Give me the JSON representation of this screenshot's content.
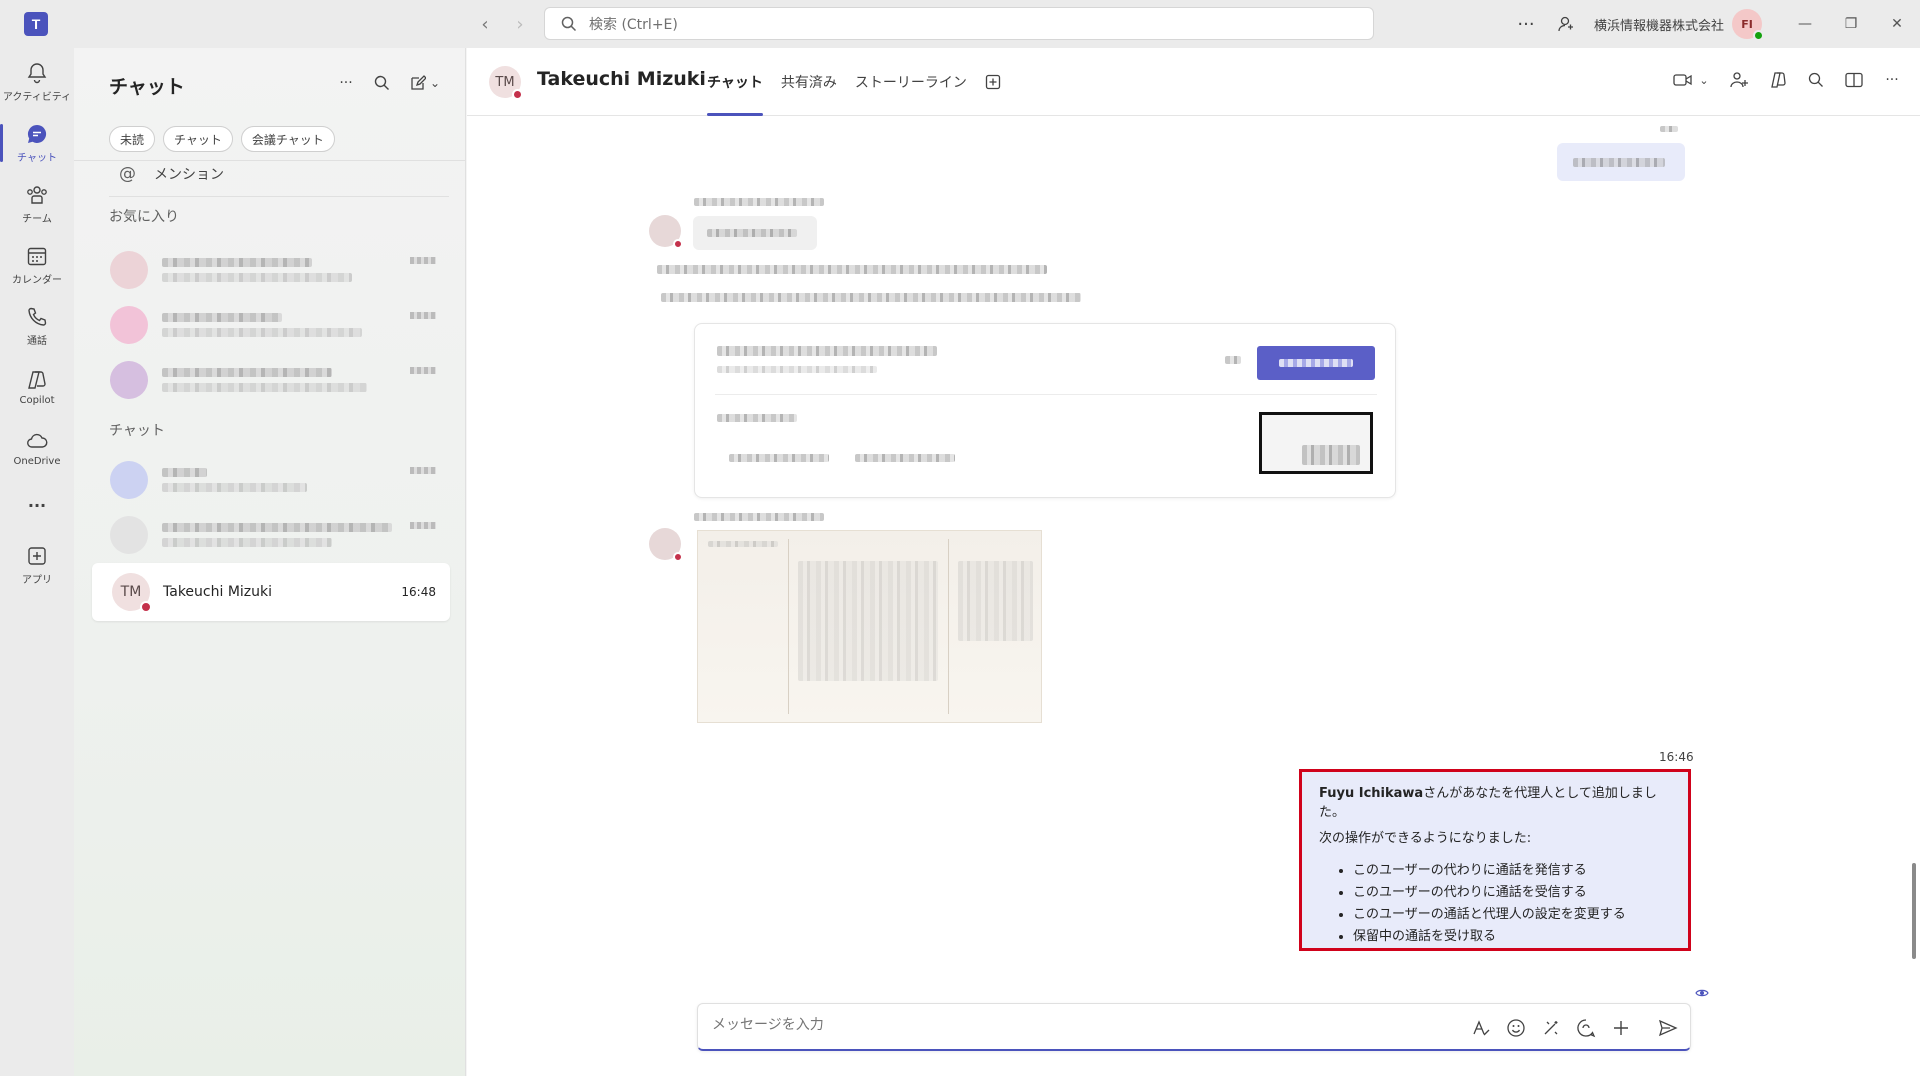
{
  "titlebar": {
    "search_placeholder": "検索 (Ctrl+E)",
    "org_name": "横浜情報機器株式会社",
    "user_initials": "FI",
    "more": "···"
  },
  "rail": {
    "items": [
      {
        "label": "アクティビティ",
        "icon": "bell-icon"
      },
      {
        "label": "チャット",
        "icon": "chat-icon",
        "active": true
      },
      {
        "label": "チーム",
        "icon": "teams-icon"
      },
      {
        "label": "カレンダー",
        "icon": "calendar-icon"
      },
      {
        "label": "通話",
        "icon": "phone-icon"
      },
      {
        "label": "Copilot",
        "icon": "copilot-icon"
      },
      {
        "label": "OneDrive",
        "icon": "cloud-icon"
      },
      {
        "label": "···",
        "icon": "more-icon"
      },
      {
        "label": "アプリ",
        "icon": "add-app-icon"
      }
    ]
  },
  "leftpane": {
    "title": "チャット",
    "filters": [
      "未読",
      "チャット",
      "会議チャット"
    ],
    "mention": "メンション",
    "favorites_label": "お気に入り",
    "chats_label": "チャット",
    "active_chat": {
      "initials": "TM",
      "name": "Takeuchi Mizuki",
      "time": "16:48"
    }
  },
  "header": {
    "initials": "TM",
    "name": "Takeuchi Mizuki",
    "tabs": [
      {
        "label": "チャット",
        "active": true
      },
      {
        "label": "共有済み"
      },
      {
        "label": "ストーリーライン"
      }
    ]
  },
  "messages": {
    "highlighted": {
      "time": "16:46",
      "title_bold": "Fuyu Ichikawa",
      "title_rest": "さんがあなたを代理人として追加しました。",
      "subtitle": "次の操作ができるようになりました:",
      "items": [
        "このユーザーの代わりに通話を発信する",
        "このユーザーの代わりに通話を受信する",
        "このユーザーの通話と代理人の設定を変更する",
        "保留中の通話を受け取る"
      ]
    }
  },
  "composer": {
    "placeholder": "メッセージを入力"
  },
  "colors": {
    "accent": "#4b53bc",
    "highlight_border": "#d0021b",
    "bubble_me": "#e8ebfa",
    "dnd": "#c4314b",
    "available": "#13a10e"
  }
}
